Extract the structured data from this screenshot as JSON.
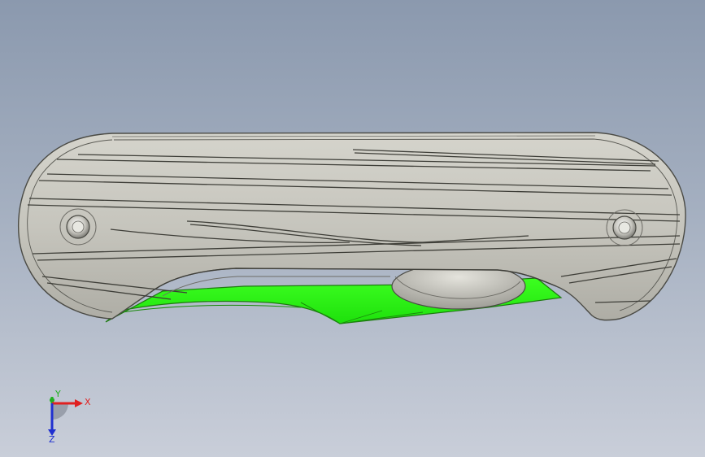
{
  "viewport": {
    "background_top": "#8b99ae",
    "background_bottom": "#c9ced9"
  },
  "model": {
    "handle_color": "#c6c5bd",
    "handle_edge_color": "#4a4a44",
    "blade_color": "#2cff12",
    "blade_edge_color": "#1d7a10",
    "pivot_color": "#bdbcb3"
  },
  "triad": {
    "x_label": "X",
    "y_label": "Y",
    "z_label": "Z",
    "x_color": "#e02020",
    "y_color": "#20b020",
    "z_color": "#2030d0"
  }
}
